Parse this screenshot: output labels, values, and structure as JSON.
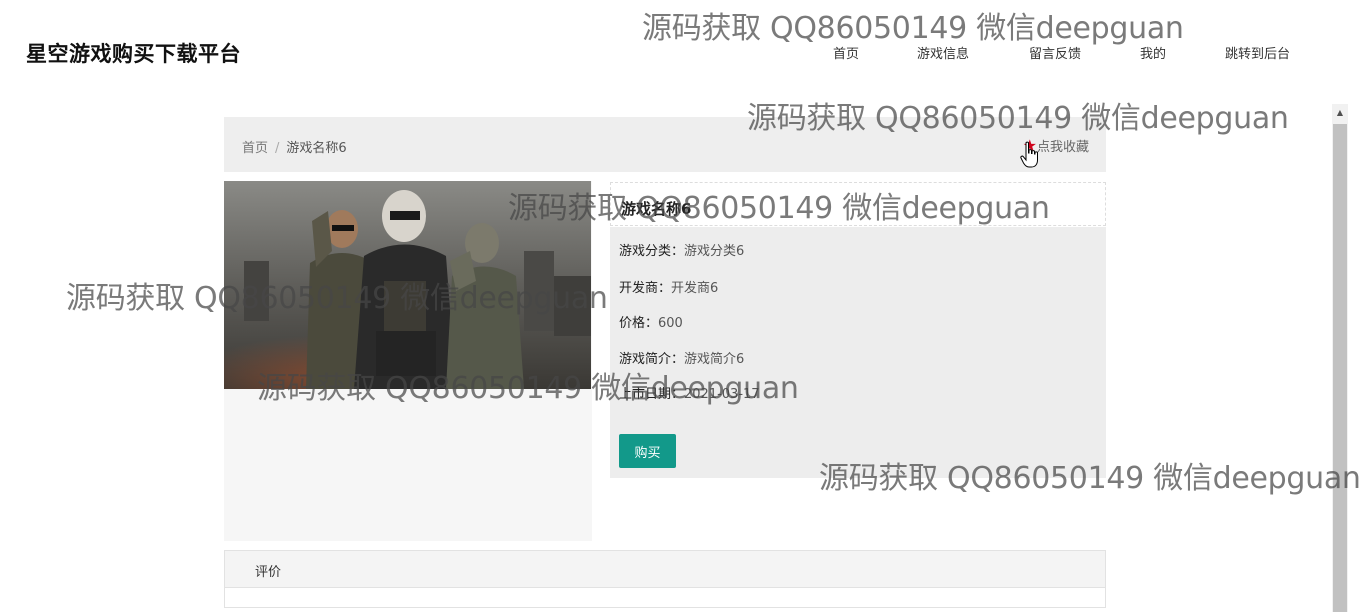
{
  "site": {
    "title": "星空游戏购买下载平台"
  },
  "nav": {
    "items": [
      {
        "label": "首页"
      },
      {
        "label": "游戏信息"
      },
      {
        "label": "留言反馈"
      },
      {
        "label": "我的"
      },
      {
        "label": "跳转到后台"
      }
    ]
  },
  "breadcrumb": {
    "home": "首页",
    "separator": "/",
    "current": "游戏名称6"
  },
  "favorite": {
    "label": "点我收藏",
    "icon": "star-icon",
    "color": "#d0021b"
  },
  "game": {
    "title": "游戏名称6",
    "fields": [
      {
        "label": "游戏分类：",
        "value": "游戏分类6"
      },
      {
        "label": "开发商：",
        "value": "开发商6"
      },
      {
        "label": "价格：",
        "value": "600"
      },
      {
        "label": "游戏简介：",
        "value": "游戏简介6"
      },
      {
        "label": "上市日期：",
        "value": "2021-03-17"
      }
    ],
    "buy_label": "购买"
  },
  "review": {
    "header": "评价"
  },
  "watermark": {
    "text": "源码获取 QQ86050149 微信deepguan"
  },
  "colors": {
    "accent": "#12998a",
    "star": "#d0021b"
  }
}
